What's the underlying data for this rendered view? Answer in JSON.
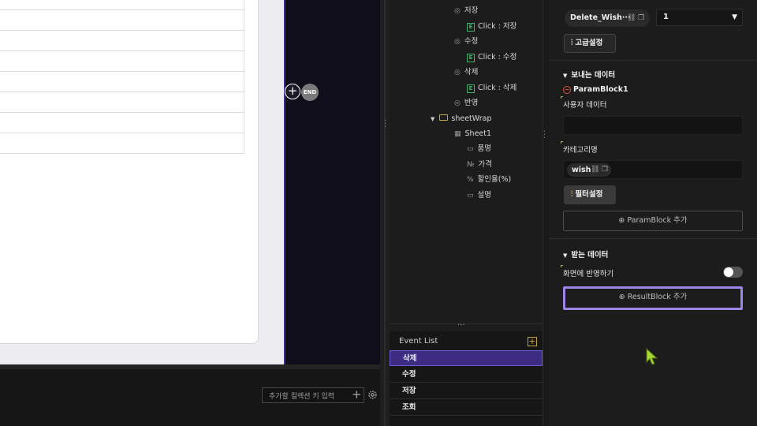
{
  "canvas": {
    "end_label": "END",
    "plus_symbol": "+"
  },
  "bottom_bar": {
    "key_input_placeholder": "추가할 컬렉션 키 입력",
    "add_symbol": "+"
  },
  "tree": {
    "items": [
      {
        "label": "저장",
        "icon": "eye-icon"
      },
      {
        "label": "Click : 저장",
        "icon": "event-badge-icon"
      },
      {
        "label": "수정",
        "icon": "eye-icon"
      },
      {
        "label": "Click : 수정",
        "icon": "event-badge-icon"
      },
      {
        "label": "삭제",
        "icon": "eye-icon"
      },
      {
        "label": "Click : 삭제",
        "icon": "event-badge-icon"
      },
      {
        "label": "반영",
        "icon": "eye-icon"
      },
      {
        "label": "sheetWrap",
        "icon": "folder-icon"
      },
      {
        "label": "Sheet1",
        "icon": "grid-icon"
      },
      {
        "label": "품명",
        "icon": "text-field-icon"
      },
      {
        "label": "가격",
        "icon": "number-field-icon"
      },
      {
        "label": "할인율(%)",
        "icon": "percent-field-icon"
      },
      {
        "label": "설명",
        "icon": "text-field-icon"
      }
    ],
    "event_badge": "E"
  },
  "event_list": {
    "title": "Event List",
    "add_symbol": "+",
    "events": [
      "삭제",
      "수정",
      "저장",
      "조회"
    ],
    "active_index": 0
  },
  "properties": {
    "function_name": "Delete_Wish···",
    "count_value": "1",
    "advanced_button": "고급설정",
    "send_section": "보내는 데이터",
    "param_block": "ParamBlock1",
    "user_data_label": "사용자 데이터",
    "category_label": "카테고리명",
    "category_chip": "wish",
    "filter_button": "필터설정",
    "add_param_button": "ParamBlock 추가",
    "receive_section": "받는 데이터",
    "reflect_label": "화면에 반영하기",
    "reflect_toggle_on": false,
    "add_result_button": "ResultBlock 추가"
  },
  "colors": {
    "accent_purple": "#9e86e8",
    "active_event_bg": "#3c2c82",
    "badge_green": "#3fb36b",
    "folder_gold": "#c9a447",
    "cursor_green": "#a6d630"
  }
}
